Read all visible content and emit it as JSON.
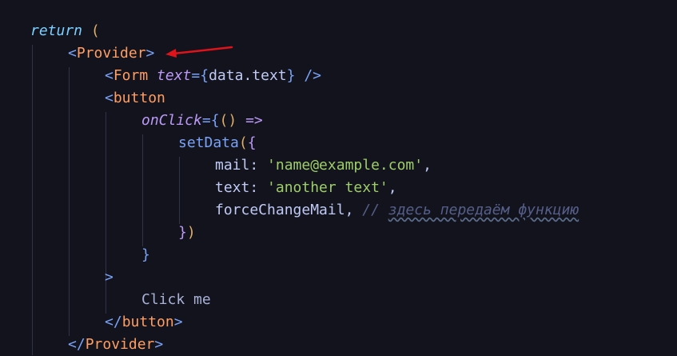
{
  "code": {
    "l1": {
      "kw": "return",
      "paren": " ("
    },
    "l2": {
      "open": "<",
      "tag": "Provider",
      "close": ">"
    },
    "l3": {
      "open": "<",
      "tag": "Form",
      "attr": "text",
      "eq": "=",
      "lb": "{",
      "expr": "data.text",
      "rb": "}",
      "close": " />"
    },
    "l4": {
      "open": "<",
      "tag": "button"
    },
    "l5": {
      "attr": "onClick",
      "eq": "=",
      "lb": "{",
      "args": "()",
      "arrow": " =>"
    },
    "l6": {
      "fn": "setData",
      "lp": "(",
      "lb": "{"
    },
    "l7": {
      "key": "mail: ",
      "val": "'name@example.com'",
      "comma": ","
    },
    "l8": {
      "key": "text: ",
      "val": "'another text'",
      "comma": ","
    },
    "l9": {
      "key": "forceChangeMail",
      "comma": ", ",
      "slashes": "// ",
      "comment": "здесь передаём функцию"
    },
    "l10": {
      "rb": "}",
      "rp": ")"
    },
    "l11": {
      "rb": "}"
    },
    "l12": {
      "close": ">"
    },
    "l13": {
      "text": "Click me"
    },
    "l14": {
      "open": "</",
      "tag": "button",
      "close": ">"
    },
    "l15": {
      "open": "</",
      "tag": "Provider",
      "close": ">"
    }
  },
  "colors": {
    "background": "#12131c",
    "annotation_arrow": "#e0131a"
  }
}
